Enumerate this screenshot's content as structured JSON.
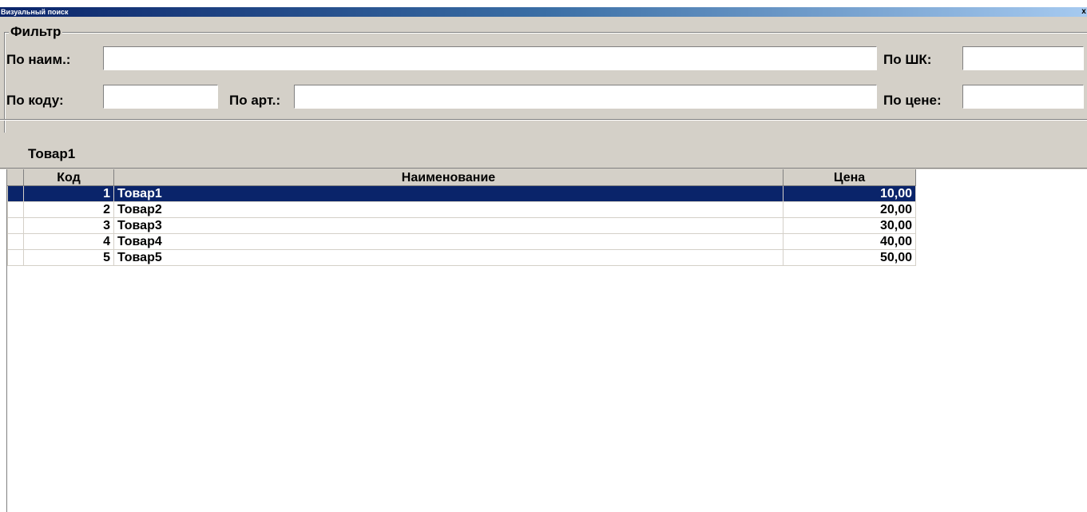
{
  "window": {
    "title": "Визуальный поиск",
    "close_glyph": "x"
  },
  "filter": {
    "title": "Фильтр",
    "name_label": "По наим.:",
    "name_value": "",
    "barcode_label": "По ШК:",
    "barcode_value": "",
    "code_label": "По коду:",
    "code_value": "",
    "article_label": "По арт.:",
    "article_value": "",
    "price_label": "По цене:",
    "price_value": ""
  },
  "current_item": "Товар1",
  "table": {
    "columns": {
      "code": "Код",
      "name": "Наименование",
      "price": "Цена"
    },
    "rows": [
      {
        "code": "1",
        "name": "Товар1",
        "price": "10,00",
        "selected": true
      },
      {
        "code": "2",
        "name": "Товар2",
        "price": "20,00"
      },
      {
        "code": "3",
        "name": "Товар3",
        "price": "30,00"
      },
      {
        "code": "4",
        "name": "Товар4",
        "price": "40,00"
      },
      {
        "code": "5",
        "name": "Товар5",
        "price": "50,00"
      }
    ]
  },
  "colors": {
    "selection": "#0a246a",
    "panel": "#d4d0c8"
  }
}
